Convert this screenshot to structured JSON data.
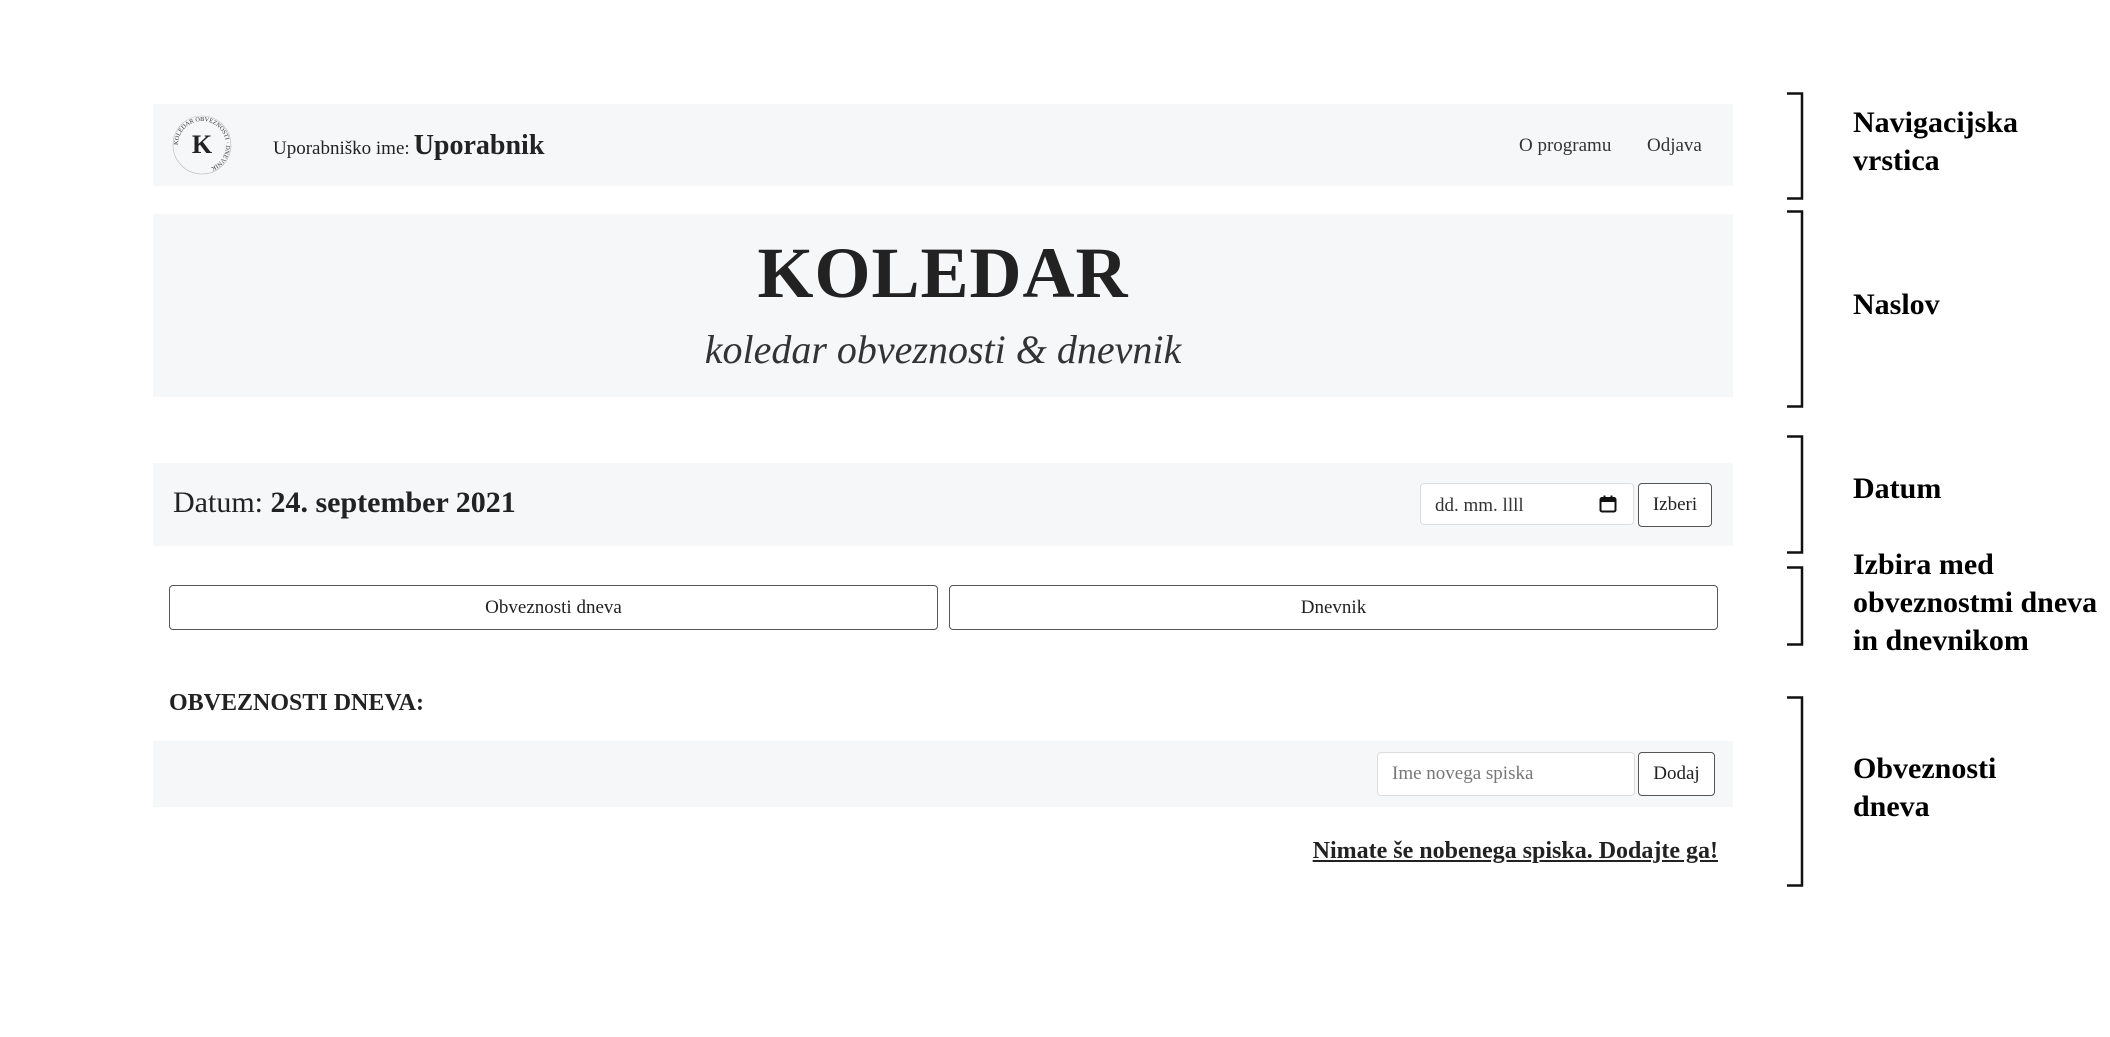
{
  "navbar": {
    "logo_letter": "K",
    "logo_ring_text": "KOLEDAR OBVEZNOSTI · DNEVNIK",
    "username_label": "Uporabniško ime:",
    "username": "Uporabnik",
    "links": {
      "about": "O programu",
      "logout": "Odjava"
    }
  },
  "header": {
    "title": "KOLEDAR",
    "subtitle": "koledar obveznosti & dnevnik"
  },
  "datebar": {
    "label": "Datum:",
    "value": "24. september 2021",
    "date_input_placeholder": "dd. mm. llll",
    "select_button": "Izberi"
  },
  "toggles": {
    "obligations": "Obveznosti dneva",
    "diary": "Dnevnik"
  },
  "obligations": {
    "heading": "OBVEZNOSTI DNEVA:",
    "new_list_placeholder": "Ime novega spiska",
    "add_button": "Dodaj",
    "empty_message": "Nimate še nobenega spiska. Dodajte ga!"
  },
  "annotations": {
    "navbar": [
      "Navigacijska",
      "vrstica"
    ],
    "title": [
      "Naslov"
    ],
    "date": [
      "Datum"
    ],
    "choice": [
      "Izbira med",
      "obveznostmi dneva",
      "in dnevnikom"
    ],
    "obligations": [
      "Obveznosti",
      "dneva"
    ]
  }
}
